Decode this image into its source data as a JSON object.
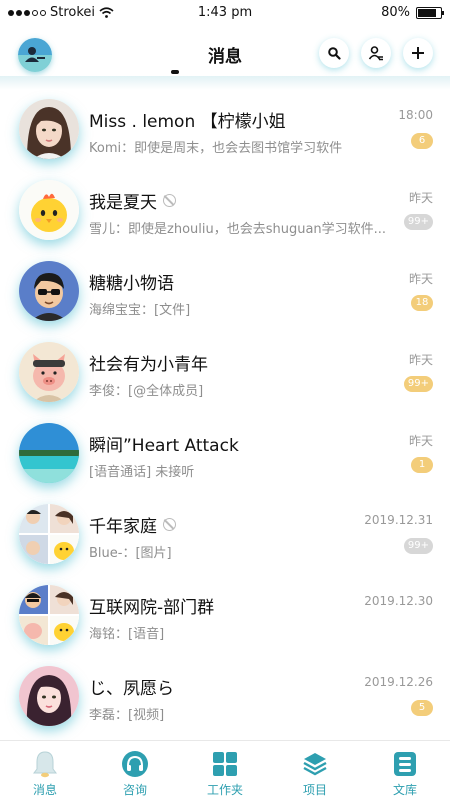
{
  "status_bar": {
    "carrier": "Strokei",
    "time": "1:43 pm",
    "battery": "80%",
    "battery_level": 0.8
  },
  "header": {
    "title": "消息",
    "buttons": [
      "search-icon",
      "contacts-icon",
      "plus-icon"
    ]
  },
  "conversations": [
    {
      "name": "Miss . lemon 【柠檬小姐",
      "message": "Komi：即使是周末，也会去图书馆学习软件",
      "time": "18:00",
      "badge": "6",
      "badge_color": "#f3cd7a",
      "muted": false
    },
    {
      "name": "我是夏天",
      "message": "雪儿：即使是zhouliu，也会去shuguan学习软件...",
      "time": "昨天",
      "badge": "99+",
      "badge_color": "#d7d7d7",
      "muted": true
    },
    {
      "name": "糖糖小物语",
      "message": "海绵宝宝：[文件]",
      "time": "昨天",
      "badge": "18",
      "badge_color": "#f3cd7a",
      "muted": false
    },
    {
      "name": "社会有为小青年",
      "message": "李俊：[@全体成员]",
      "time": "昨天",
      "badge": "99+",
      "badge_color": "#f3cd7a",
      "muted": false
    },
    {
      "name": "瞬间”Heart Attack",
      "message": "[语音通话] 未接听",
      "time": "昨天",
      "badge": "1",
      "badge_color": "#f3cd7a",
      "muted": false
    },
    {
      "name": "千年家庭",
      "message": "Blue-：[图片]",
      "time": "2019.12.31",
      "badge": "99+",
      "badge_color": "#d7d7d7",
      "muted": true
    },
    {
      "name": "互联网院-部门群",
      "message": "海铭：[语音]",
      "time": "2019.12.30",
      "badge": "",
      "badge_color": "",
      "muted": false
    },
    {
      "name": "じ、夙愿ら",
      "message": "李磊：[视频]",
      "time": "2019.12.26",
      "badge": "5",
      "badge_color": "#f3cd7a",
      "muted": false
    }
  ],
  "tabs": [
    {
      "label": "消息",
      "icon": "bell-icon",
      "active": true
    },
    {
      "label": "咨询",
      "icon": "headphones-icon",
      "active": false
    },
    {
      "label": "工作夹",
      "icon": "grid-icon",
      "active": false
    },
    {
      "label": "项目",
      "icon": "layers-icon",
      "active": false
    },
    {
      "label": "文库",
      "icon": "library-icon",
      "active": false
    }
  ],
  "colors": {
    "accent": "#2e9fb0",
    "badge_gold": "#f3cd7a",
    "badge_grey": "#d7d7d7"
  }
}
